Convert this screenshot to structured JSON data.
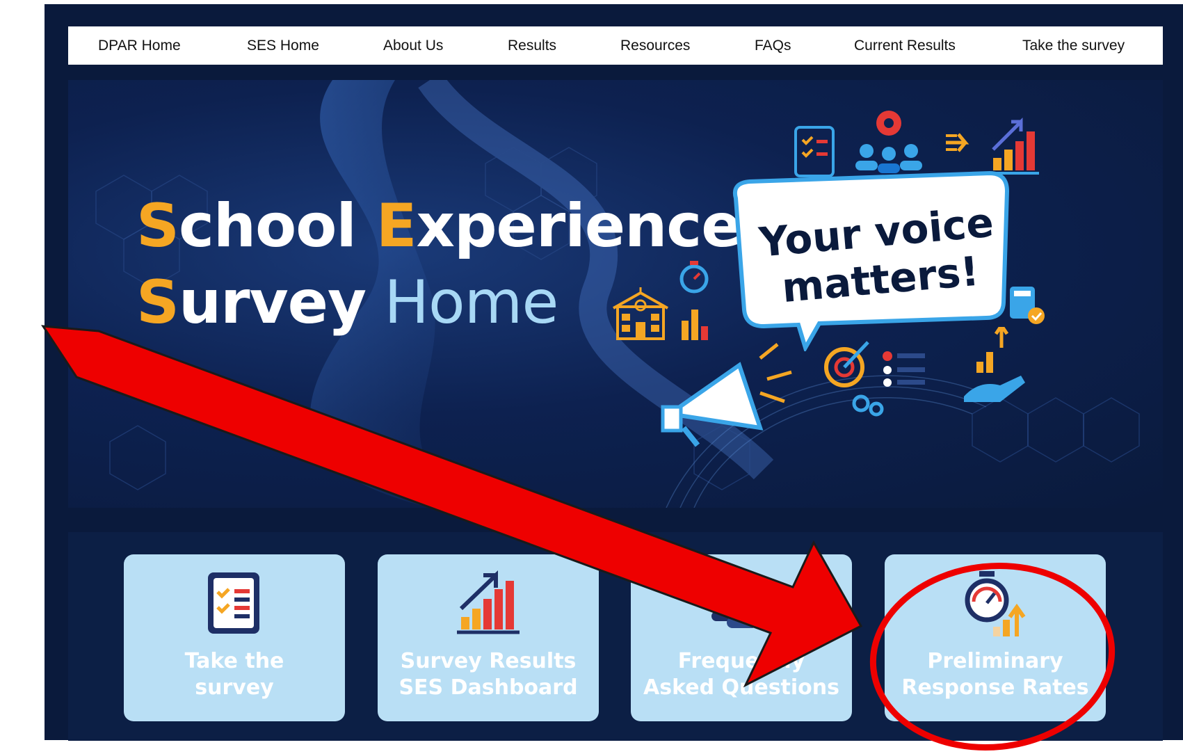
{
  "nav": {
    "items": [
      {
        "label": "DPAR Home"
      },
      {
        "label": "SES Home"
      },
      {
        "label": "About Us"
      },
      {
        "label": "Results"
      },
      {
        "label": "Resources"
      },
      {
        "label": "FAQs"
      },
      {
        "label": "Current Results"
      },
      {
        "label": "Take the survey"
      }
    ]
  },
  "hero": {
    "title_line1_a": "S",
    "title_line1_b": "chool ",
    "title_line1_c": "E",
    "title_line1_d": "xperience",
    "title_line2_a": "S",
    "title_line2_b": "urvey",
    "title_line2_c": " Home",
    "speech_line1": "Your voice",
    "speech_line2": "matters!"
  },
  "cards": [
    {
      "label": "Take the\nsurvey",
      "icon": "clipboard-checklist-icon"
    },
    {
      "label": "Survey Results\nSES Dashboard",
      "icon": "growth-chart-icon"
    },
    {
      "label": "Frequently\nAsked Questions",
      "icon": "people-group-icon"
    },
    {
      "label": "Preliminary\nResponse Rates",
      "icon": "stopwatch-chart-icon"
    }
  ],
  "colors": {
    "background": "#0a1a3c",
    "accent_orange": "#f5a623",
    "light_blue": "#a8d8f5",
    "card_bg": "#b9dff5",
    "annotation_red": "#ee0000"
  }
}
